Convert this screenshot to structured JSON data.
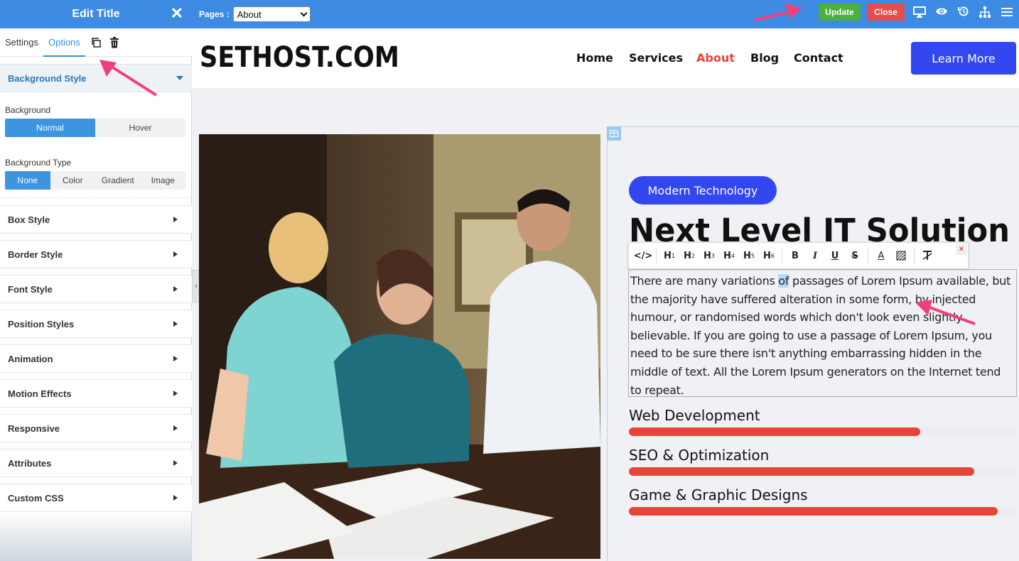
{
  "panel": {
    "title": "Edit Title",
    "tabs": [
      {
        "label": "Settings",
        "active": false
      },
      {
        "label": "Options",
        "active": true
      }
    ],
    "background_style": {
      "label": "Background Style",
      "background_label": "Background",
      "background_modes": [
        "Normal",
        "Hover"
      ],
      "background_mode_selected": "Normal",
      "background_type_label": "Background Type",
      "background_types": [
        "None",
        "Color",
        "Gradient",
        "Image"
      ],
      "background_type_selected": "None"
    },
    "sections": [
      "Box Style",
      "Border Style",
      "Font Style",
      "Position Styles",
      "Animation",
      "Motion Effects",
      "Responsive",
      "Attributes",
      "Custom CSS"
    ]
  },
  "topbar": {
    "pages_label": "Pages :",
    "pages_selected": "About",
    "update_label": "Update",
    "close_label": "Close",
    "icons": [
      "desktop-icon",
      "eye-icon",
      "history-icon",
      "sitemap-icon",
      "menu-icon"
    ]
  },
  "site": {
    "logo": "SETHOST.COM",
    "nav": [
      {
        "label": "Home",
        "active": false
      },
      {
        "label": "Services",
        "active": false
      },
      {
        "label": "About",
        "active": true
      },
      {
        "label": "Blog",
        "active": false
      },
      {
        "label": "Contact",
        "active": false
      }
    ],
    "cta_label": "Learn More",
    "badge": "Modern Technology",
    "heading": "Next Level IT Solution",
    "paragraph_before": "There are many variations ",
    "paragraph_selected": "of",
    "paragraph_after": " passages of Lorem Ipsum available, but the majority have suffered alteration in some form, by injected humour, or randomised words which don't look even slightly believable. If you are going to use a passage of Lorem Ipsum, you need to be sure there isn't anything embarrassing hidden in the middle of text. All the Lorem Ipsum generators on the Internet tend to repeat.",
    "skills": [
      {
        "name": "Web Development",
        "percent": 75
      },
      {
        "name": "SEO & Optimization",
        "percent": 89
      },
      {
        "name": "Game & Graphic Designs",
        "percent": 95
      }
    ]
  },
  "editor_toolbar": {
    "buttons": [
      "code-icon",
      "h1",
      "h2",
      "h3",
      "h4",
      "h5",
      "h6",
      "bold-icon",
      "italic-icon",
      "underline-icon",
      "strikethrough-icon",
      "text-color-icon",
      "highlight-icon",
      "clear-format-icon"
    ],
    "close_glyph": "×"
  },
  "colors": {
    "editor_blue": "#3d8be3",
    "update_green": "#4caf3e",
    "close_red": "#e74c4c",
    "brand_blue": "#3347f0",
    "nav_active": "#e8443a",
    "skill_bar": "#e8443a",
    "annotation_arrow": "#f0407a"
  }
}
